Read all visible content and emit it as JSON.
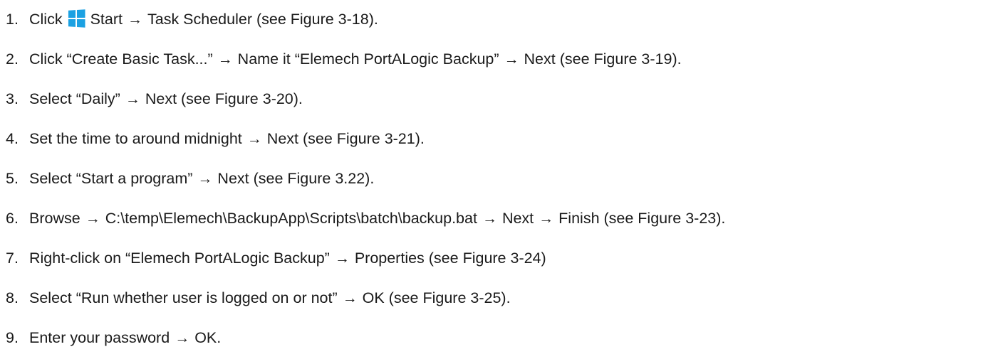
{
  "steps": [
    {
      "number": "1.",
      "segments": [
        "Click",
        "Start",
        "Task Scheduler (see Figure 3-18)."
      ],
      "icon": "windows-start-icon",
      "icon_color": "#1ba1e2"
    },
    {
      "number": "2.",
      "segments": [
        "Click “Create Basic Task...”",
        "Name it “Elemech PortALogic Backup”",
        "Next (see Figure 3-19)."
      ]
    },
    {
      "number": "3.",
      "segments": [
        "Select “Daily”",
        "Next (see Figure 3-20)."
      ]
    },
    {
      "number": "4.",
      "segments": [
        "Set the time to around midnight",
        "Next (see Figure 3-21)."
      ]
    },
    {
      "number": "5.",
      "segments": [
        "Select “Start a program”",
        "Next (see Figure 3.22)."
      ]
    },
    {
      "number": "6.",
      "segments": [
        "Browse",
        "C:\\temp\\Elemech\\BackupApp\\Scripts\\batch\\backup.bat",
        "Next",
        "Finish (see Figure 3-23)."
      ]
    },
    {
      "number": "7.",
      "segments": [
        "Right-click on “Elemech PortALogic Backup”",
        "Properties (see Figure 3-24)"
      ]
    },
    {
      "number": "8.",
      "segments": [
        "Select “Run whether user is logged on or not”",
        "OK (see Figure 3-25)."
      ]
    },
    {
      "number": "9.",
      "segments": [
        "Enter your password",
        "OK."
      ]
    }
  ],
  "arrow_glyph": "→"
}
